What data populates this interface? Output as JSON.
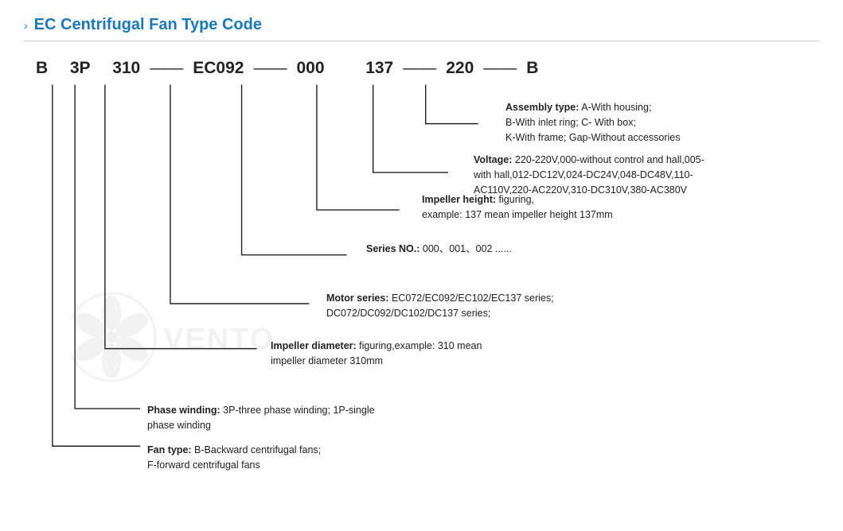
{
  "title": {
    "chevron": "›",
    "text": "EC Centrifugal Fan Type Code"
  },
  "code": {
    "segments": [
      "B",
      "3P",
      "310",
      "EC092",
      "000",
      "137",
      "220",
      "B"
    ],
    "dashes": [
      "—",
      "—",
      "—",
      "—",
      "—",
      "—"
    ]
  },
  "annotations": {
    "assembly": {
      "label": "Assembly type:",
      "text": "A-With housing;\nB-With inlet ring;  C- With box;\nK-With frame; Gap-Without accessories"
    },
    "voltage": {
      "label": "Voltage:",
      "text": "220-220V,000-without control and hall,005-with hall,012-DC12V,024-DC24V,048-DC48V,110-AC110V,220-AC220V,310-DC310V,380-AC380V"
    },
    "impeller_height": {
      "label": "Impeller height:",
      "text": "figuring,\nexample: 137 mean impeller height 137mm"
    },
    "series": {
      "label": "Series NO.:",
      "text": "000、001、002 ......"
    },
    "motor": {
      "label": "Motor series:",
      "text": "EC072/EC092/EC102/EC137 series;\nDC072/DC092/DC102/DC137 series;"
    },
    "impeller_diameter": {
      "label": "Impeller diameter:",
      "text": "figuring,example: 310 mean\nimpeller diameter 310mm"
    },
    "phase": {
      "label": "Phase winding:",
      "text": "3P-three phase winding;  1P-single\nphase winding"
    },
    "fan_type": {
      "label": "Fan type:",
      "text": "B-Backward centrifugal fans;\nF-forward centrifugal fans"
    }
  }
}
